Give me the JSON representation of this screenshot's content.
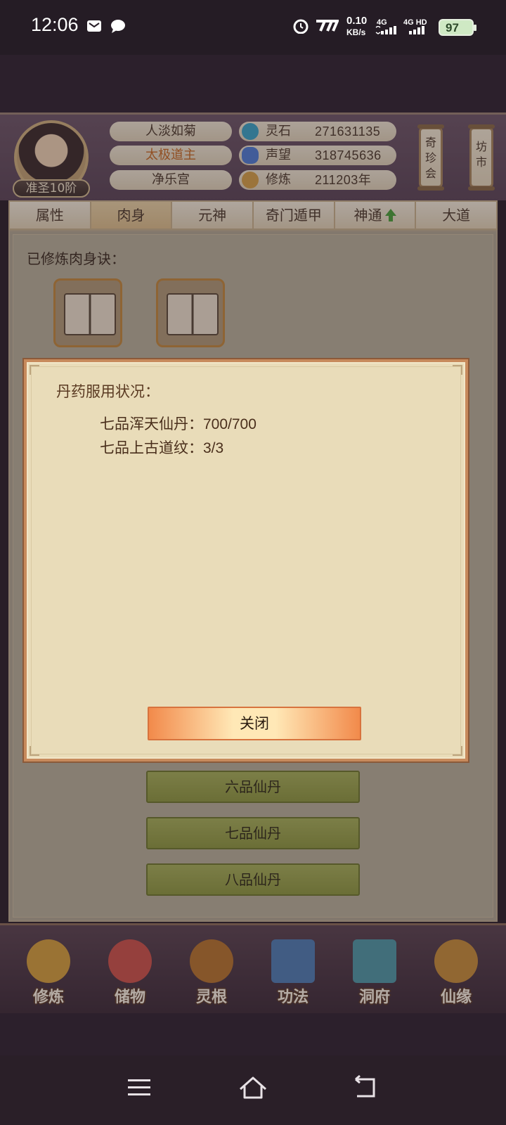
{
  "status_bar": {
    "time": "12:06",
    "speed_value": "0.10",
    "speed_unit": "KB/s",
    "net1": "4G",
    "net2": "4G HD",
    "battery": "97"
  },
  "player": {
    "name": "人淡如菊",
    "title": "太极道主",
    "sect": "净乐宫",
    "rank": "准圣10阶",
    "stats": [
      {
        "label": "灵石",
        "value": "271631135",
        "icon": "spirit-stone-icon",
        "color": "#3aa7c9"
      },
      {
        "label": "声望",
        "value": "318745636",
        "icon": "prestige-crystal-icon",
        "color": "#4f7fd8"
      },
      {
        "label": "修炼",
        "value": "211203年",
        "icon": "meditation-icon",
        "color": "#d9a347"
      }
    ]
  },
  "side_buttons": [
    {
      "label": "奇珍会"
    },
    {
      "label": "坊市"
    }
  ],
  "tabs": [
    {
      "label": "属性"
    },
    {
      "label": "肉身"
    },
    {
      "label": "元神"
    },
    {
      "label": "奇门遁甲"
    },
    {
      "label": "神通"
    },
    {
      "label": "大道"
    }
  ],
  "main": {
    "cultivated_label": "已修炼肉身诀：",
    "pill_buttons": [
      "六品仙丹",
      "七品仙丹",
      "八品仙丹"
    ]
  },
  "dialog": {
    "title": "丹药服用状况：",
    "lines": [
      {
        "label": "七品浑天仙丹：",
        "value": "700/700"
      },
      {
        "label": "七品上古道纹：",
        "value": "3/3"
      }
    ],
    "close_label": "关闭"
  },
  "bottom_nav": [
    {
      "label": "修炼",
      "icon": "monk-icon",
      "color": "#d8a23d"
    },
    {
      "label": "储物",
      "icon": "treasure-bag-icon",
      "color": "#d0544a"
    },
    {
      "label": "灵根",
      "icon": "spirit-root-emblem-icon",
      "color": "#b8762d"
    },
    {
      "label": "功法",
      "icon": "scripture-book-icon",
      "color": "#4f7fb6"
    },
    {
      "label": "洞府",
      "icon": "cave-mansion-icon",
      "color": "#4f9aa8"
    },
    {
      "label": "仙缘",
      "icon": "gourd-icon",
      "color": "#c9903a"
    }
  ]
}
